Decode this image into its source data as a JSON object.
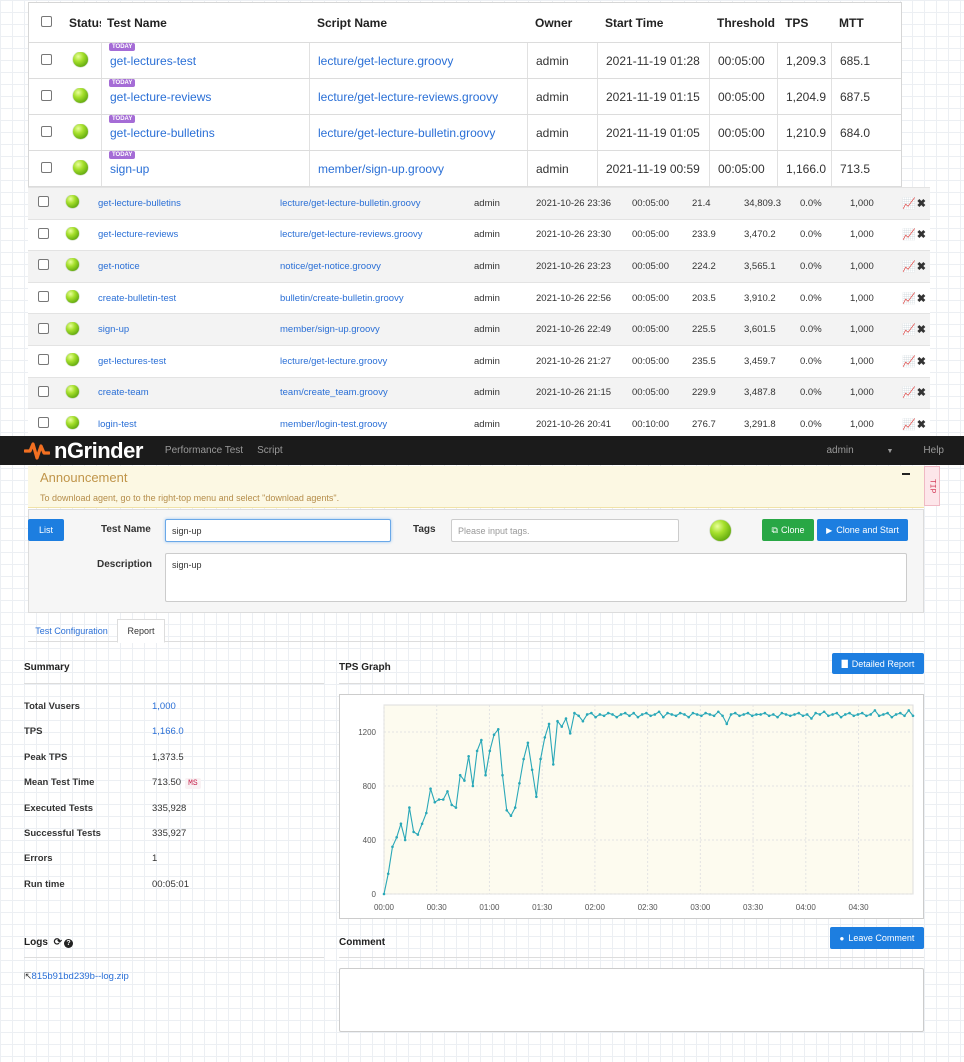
{
  "top_table": {
    "headers": [
      "Status",
      "Test Name",
      "Script Name",
      "Owner",
      "Start Time",
      "Threshold",
      "TPS",
      "MTT"
    ],
    "badge": "TODAY",
    "rows": [
      {
        "name": "get-lectures-test",
        "script": "lecture/get-lecture.groovy",
        "owner": "admin",
        "start": "2021-11-19 01:28",
        "threshold": "00:05:00",
        "tps": "1,209.3",
        "mtt": "685.1"
      },
      {
        "name": "get-lecture-reviews",
        "script": "lecture/get-lecture-reviews.groovy",
        "owner": "admin",
        "start": "2021-11-19 01:15",
        "threshold": "00:05:00",
        "tps": "1,204.9",
        "mtt": "687.5"
      },
      {
        "name": "get-lecture-bulletins",
        "script": "lecture/get-lecture-bulletin.groovy",
        "owner": "admin",
        "start": "2021-11-19 01:05",
        "threshold": "00:05:00",
        "tps": "1,210.9",
        "mtt": "684.0"
      },
      {
        "name": "sign-up",
        "script": "member/sign-up.groovy",
        "owner": "admin",
        "start": "2021-11-19 00:59",
        "threshold": "00:05:00",
        "tps": "1,166.0",
        "mtt": "713.5"
      }
    ]
  },
  "history_table": {
    "rows": [
      {
        "name": "get-lecture-bulletins",
        "script": "lecture/get-lecture-bulletin.groovy",
        "owner": "admin",
        "start": "2021-10-26 23:36",
        "threshold": "00:05:00",
        "tps": "21.4",
        "mtt": "34,809.3",
        "err": "0.0%",
        "vusers": "1,000"
      },
      {
        "name": "get-lecture-reviews",
        "script": "lecture/get-lecture-reviews.groovy",
        "owner": "admin",
        "start": "2021-10-26 23:30",
        "threshold": "00:05:00",
        "tps": "233.9",
        "mtt": "3,470.2",
        "err": "0.0%",
        "vusers": "1,000"
      },
      {
        "name": "get-notice",
        "script": "notice/get-notice.groovy",
        "owner": "admin",
        "start": "2021-10-26 23:23",
        "threshold": "00:05:00",
        "tps": "224.2",
        "mtt": "3,565.1",
        "err": "0.0%",
        "vusers": "1,000"
      },
      {
        "name": "create-bulletin-test",
        "script": "bulletin/create-bulletin.groovy",
        "owner": "admin",
        "start": "2021-10-26 22:56",
        "threshold": "00:05:00",
        "tps": "203.5",
        "mtt": "3,910.2",
        "err": "0.0%",
        "vusers": "1,000"
      },
      {
        "name": "sign-up",
        "script": "member/sign-up.groovy",
        "owner": "admin",
        "start": "2021-10-26 22:49",
        "threshold": "00:05:00",
        "tps": "225.5",
        "mtt": "3,601.5",
        "err": "0.0%",
        "vusers": "1,000"
      },
      {
        "name": "get-lectures-test",
        "script": "lecture/get-lecture.groovy",
        "owner": "admin",
        "start": "2021-10-26 21:27",
        "threshold": "00:05:00",
        "tps": "235.5",
        "mtt": "3,459.7",
        "err": "0.0%",
        "vusers": "1,000"
      },
      {
        "name": "create-team",
        "script": "team/create_team.groovy",
        "owner": "admin",
        "start": "2021-10-26 21:15",
        "threshold": "00:05:00",
        "tps": "229.9",
        "mtt": "3,487.8",
        "err": "0.0%",
        "vusers": "1,000"
      },
      {
        "name": "login-test",
        "script": "member/login-test.groovy",
        "owner": "admin",
        "start": "2021-10-26 20:41",
        "threshold": "00:10:00",
        "tps": "276.7",
        "mtt": "3,291.8",
        "err": "0.0%",
        "vusers": "1,000"
      }
    ]
  },
  "navbar": {
    "brand": "nGrinder",
    "links": [
      "Performance Test",
      "Script"
    ],
    "user": "admin",
    "help": "Help"
  },
  "announcement": {
    "title": "Announcement",
    "text": "To download agent, go to the right-top menu and select \"download agents\".",
    "tip": "TIP"
  },
  "form": {
    "list_button": "List",
    "test_name_label": "Test Name",
    "test_name_value": "sign-up",
    "tags_label": "Tags",
    "tags_placeholder": "Please input tags.",
    "clone_button": "Clone",
    "clone_start_button": "Clone and Start",
    "description_label": "Description",
    "description_value": "sign-up"
  },
  "tabs": [
    "Test Configuration",
    "Report"
  ],
  "summary": {
    "title": "Summary",
    "rows": [
      {
        "label": "Total Vusers",
        "value": "1,000"
      },
      {
        "label": "TPS",
        "value": "1,166.0"
      },
      {
        "label": "Peak TPS",
        "value": "1,373.5"
      },
      {
        "label": "Mean Test Time",
        "value": "713.50",
        "unit": "MS"
      },
      {
        "label": "Executed Tests",
        "value": "335,928"
      },
      {
        "label": "Successful Tests",
        "value": "335,927"
      },
      {
        "label": "Errors",
        "value": "1"
      },
      {
        "label": "Run time",
        "value": "00:05:01"
      }
    ]
  },
  "tps_graph": {
    "title": "TPS Graph",
    "detailed_button": "Detailed Report"
  },
  "chart_data": {
    "type": "line",
    "title": "",
    "xlabel": "",
    "ylabel": "",
    "x_ticks": [
      "00:00",
      "00:30",
      "01:00",
      "01:30",
      "02:00",
      "02:30",
      "03:00",
      "03:30",
      "04:00",
      "04:30"
    ],
    "y_ticks": [
      0,
      400,
      800,
      1200
    ],
    "ylim": [
      0,
      1400
    ],
    "xlim_seconds": [
      0,
      301
    ],
    "series": [
      {
        "values": [
          0,
          150,
          350,
          420,
          520,
          400,
          640,
          460,
          440,
          520,
          600,
          780,
          680,
          700,
          700,
          760,
          660,
          640,
          880,
          840,
          1020,
          800,
          1060,
          1140,
          880,
          1060,
          1180,
          1220,
          880,
          620,
          580,
          640,
          820,
          1000,
          1120,
          920,
          720,
          1000,
          1160,
          1260,
          960,
          1280,
          1240,
          1300,
          1190,
          1340,
          1320,
          1280,
          1330,
          1340,
          1310,
          1330,
          1320,
          1340,
          1330,
          1310,
          1330,
          1340,
          1320,
          1340,
          1310,
          1330,
          1340,
          1320,
          1330,
          1350,
          1310,
          1340,
          1330,
          1320,
          1340,
          1330,
          1310,
          1340,
          1330,
          1320,
          1340,
          1330,
          1320,
          1350,
          1320,
          1260,
          1330,
          1340,
          1320,
          1330,
          1340,
          1320,
          1330,
          1330,
          1340,
          1320,
          1330,
          1310,
          1340,
          1330,
          1320,
          1330,
          1340,
          1320,
          1330,
          1300,
          1340,
          1330,
          1350,
          1320,
          1330,
          1340,
          1310,
          1330,
          1340,
          1320,
          1330,
          1340,
          1320,
          1330,
          1360,
          1320,
          1330,
          1340,
          1310,
          1330,
          1340,
          1320,
          1360,
          1320
        ]
      }
    ],
    "line_color": "#2aa8b8",
    "background": "#fdfbef"
  },
  "logs": {
    "title": "Logs",
    "file": "815b91bd239b--log.zip"
  },
  "comment": {
    "title": "Comment",
    "button": "Leave Comment"
  },
  "colors": {
    "primary": "#1d7ee0",
    "success": "#28a745",
    "navbar": "#1b1b1b",
    "logo_orange": "#f26f21"
  }
}
